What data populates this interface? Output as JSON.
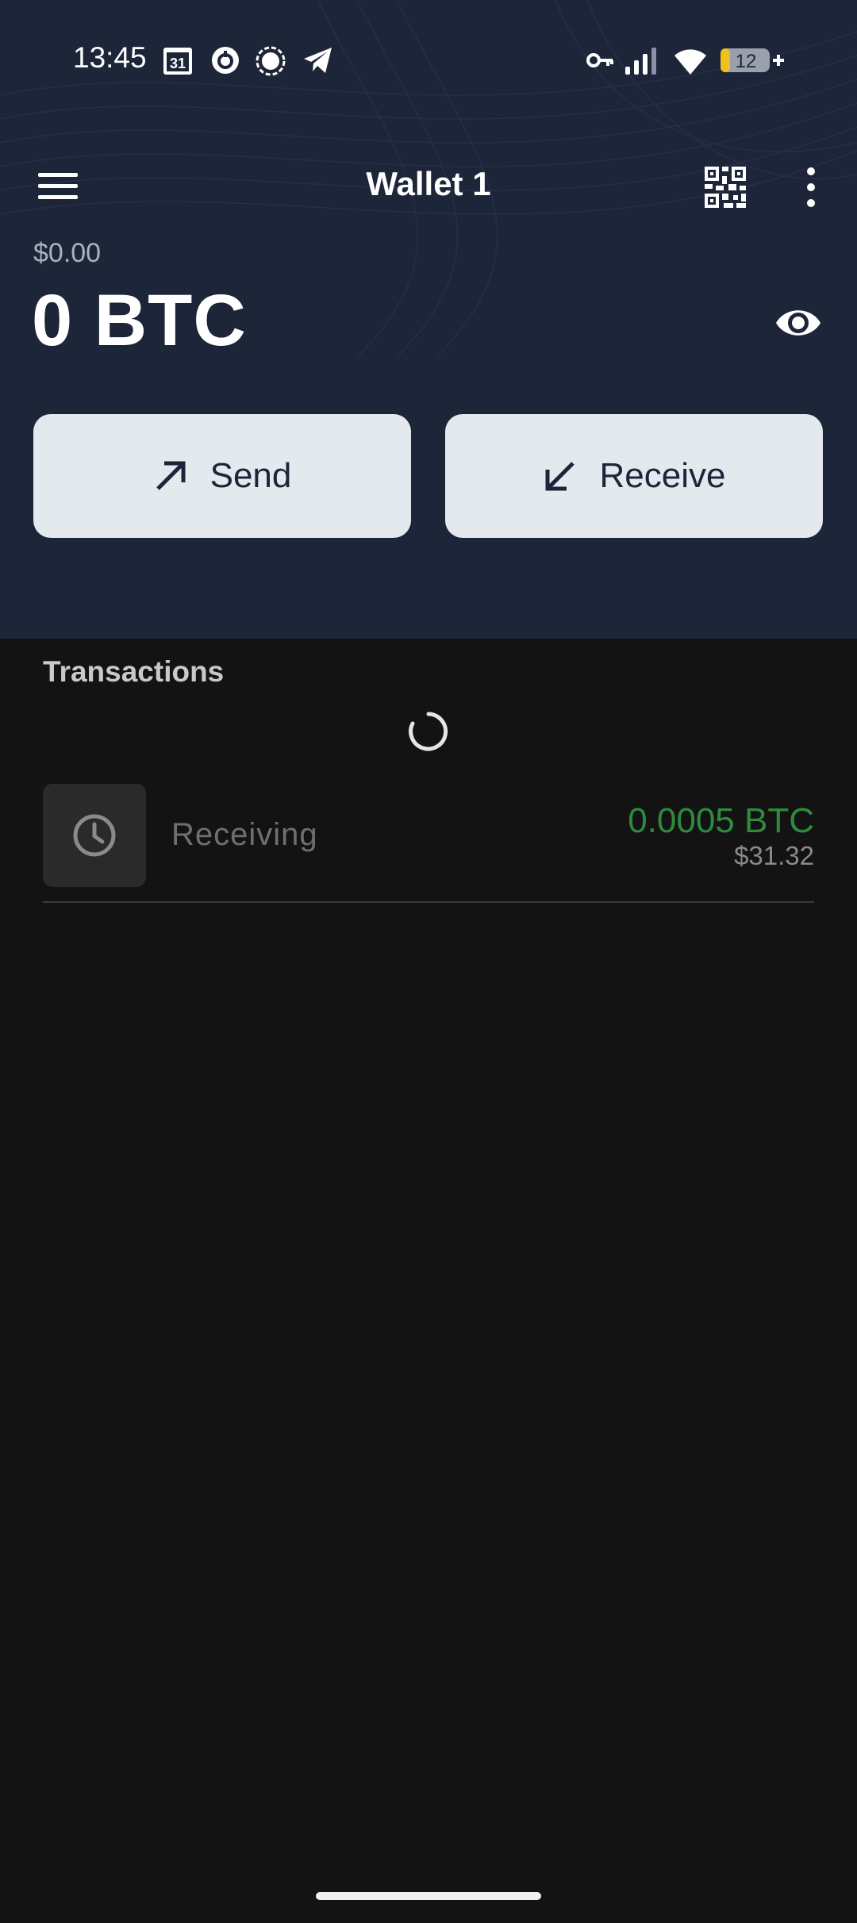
{
  "status_bar": {
    "time": "13:45",
    "calendar_day": "31",
    "battery_level": "12",
    "icons": [
      "calendar-icon",
      "sync-icon",
      "signal-app-icon",
      "telegram-icon",
      "vpn-key-icon",
      "cellular-signal-icon",
      "wifi-icon",
      "battery-icon"
    ]
  },
  "app_bar": {
    "title": "Wallet 1",
    "menu_icon": "hamburger-menu-icon",
    "qr_icon": "qr-code-icon",
    "more_icon": "more-vert-icon"
  },
  "balance": {
    "fiat": "$0.00",
    "btc": "0 BTC",
    "visibility_icon": "eye-icon"
  },
  "actions": {
    "send_label": "Send",
    "receive_label": "Receive"
  },
  "transactions": {
    "title": "Transactions",
    "items": [
      {
        "label": "Receiving",
        "amount": "0.0005 BTC",
        "fiat": "$31.32",
        "icon": "clock-icon"
      }
    ]
  },
  "colors": {
    "header_bg": "#1d2539",
    "body_bg": "#131313",
    "button_bg": "#e4e9ee",
    "incoming_amount": "#2e8b3e",
    "battery_low": "#f0c020"
  }
}
